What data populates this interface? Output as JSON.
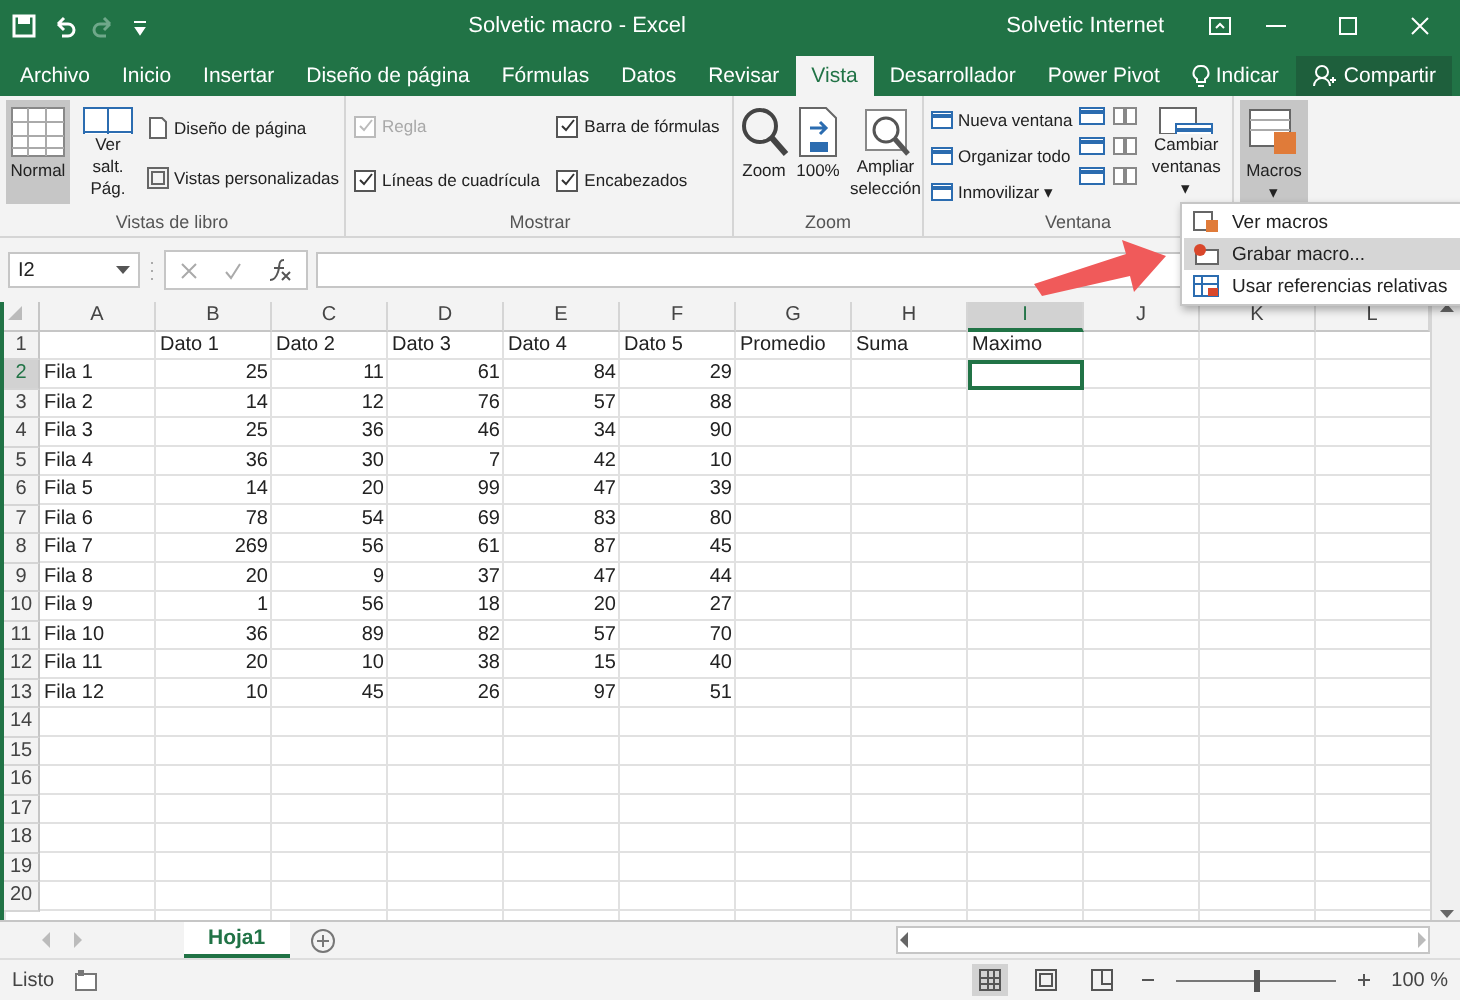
{
  "window": {
    "title": "Solvetic macro  -  Excel",
    "account": "Solvetic Internet"
  },
  "tabs": [
    {
      "label": "Archivo",
      "selected": false
    },
    {
      "label": "Inicio",
      "selected": false
    },
    {
      "label": "Insertar",
      "selected": false
    },
    {
      "label": "Diseño de página",
      "selected": false
    },
    {
      "label": "Fórmulas",
      "selected": false
    },
    {
      "label": "Datos",
      "selected": false
    },
    {
      "label": "Revisar",
      "selected": false
    },
    {
      "label": "Vista",
      "selected": true
    },
    {
      "label": "Desarrollador",
      "selected": false
    },
    {
      "label": "Power Pivot",
      "selected": false
    }
  ],
  "tell_me": "Indicar",
  "share": "Compartir",
  "ribbon": {
    "views": {
      "label": "Vistas de libro",
      "large": [
        {
          "label": "Normal",
          "selected": true
        },
        {
          "label": "Ver salt. Pág.",
          "selected": false
        }
      ],
      "small": [
        "Diseño de página",
        "Vistas personalizadas"
      ]
    },
    "show": {
      "label": "Mostrar",
      "checks": [
        {
          "label": "Regla",
          "checked": true,
          "disabled": true
        },
        {
          "label": "Líneas de cuadrícula",
          "checked": true,
          "disabled": false
        },
        {
          "label": "Barra de fórmulas",
          "checked": true,
          "disabled": false
        },
        {
          "label": "Encabezados",
          "checked": true,
          "disabled": false
        }
      ]
    },
    "zoom": {
      "label": "Zoom",
      "buttons": [
        "Zoom",
        "100%",
        "Ampliar selección"
      ]
    },
    "window": {
      "label": "Ventana",
      "small": [
        "Nueva ventana",
        "Organizar todo",
        "Inmovilizar ▾"
      ],
      "switch": "Cambiar ventanas ▾"
    },
    "macros": {
      "label": "Macros",
      "caret": "▾",
      "selected": true
    }
  },
  "macro_menu": [
    {
      "label": "Ver macros",
      "selected": false
    },
    {
      "label": "Grabar macro...",
      "selected": true
    },
    {
      "label": "Usar referencias relativas",
      "selected": false
    }
  ],
  "name_box": "I2",
  "columns": [
    {
      "letter": "A",
      "selected": false
    },
    {
      "letter": "B",
      "selected": false
    },
    {
      "letter": "C",
      "selected": false
    },
    {
      "letter": "D",
      "selected": false
    },
    {
      "letter": "E",
      "selected": false
    },
    {
      "letter": "F",
      "selected": false
    },
    {
      "letter": "G",
      "selected": false
    },
    {
      "letter": "H",
      "selected": false
    },
    {
      "letter": "I",
      "selected": true
    },
    {
      "letter": "J",
      "selected": false
    },
    {
      "letter": "K",
      "selected": false
    },
    {
      "letter": "L",
      "selected": false
    }
  ],
  "rows": [
    {
      "number": "1",
      "selected": false,
      "cells": [
        null,
        "Dato 1",
        "Dato 2",
        "Dato 3",
        "Dato 4",
        "Dato 5",
        "Promedio",
        "Suma",
        "Maximo"
      ]
    },
    {
      "number": "2",
      "selected": true,
      "cells": [
        "Fila 1",
        "25",
        "11",
        "61",
        "84",
        "29"
      ]
    },
    {
      "number": "3",
      "selected": false,
      "cells": [
        "Fila 2",
        "14",
        "12",
        "76",
        "57",
        "88"
      ]
    },
    {
      "number": "4",
      "selected": false,
      "cells": [
        "Fila 3",
        "25",
        "36",
        "46",
        "34",
        "90"
      ]
    },
    {
      "number": "5",
      "selected": false,
      "cells": [
        "Fila 4",
        "36",
        "30",
        "7",
        "42",
        "10"
      ]
    },
    {
      "number": "6",
      "selected": false,
      "cells": [
        "Fila 5",
        "14",
        "20",
        "99",
        "47",
        "39"
      ]
    },
    {
      "number": "7",
      "selected": false,
      "cells": [
        "Fila 6",
        "78",
        "54",
        "69",
        "83",
        "80"
      ]
    },
    {
      "number": "8",
      "selected": false,
      "cells": [
        "Fila 7",
        "269",
        "56",
        "61",
        "87",
        "45"
      ]
    },
    {
      "number": "9",
      "selected": false,
      "cells": [
        "Fila 8",
        "20",
        "9",
        "37",
        "47",
        "44"
      ]
    },
    {
      "number": "10",
      "selected": false,
      "cells": [
        "Fila 9",
        "1",
        "56",
        "18",
        "20",
        "27"
      ]
    },
    {
      "number": "11",
      "selected": false,
      "cells": [
        "Fila 10",
        "36",
        "89",
        "82",
        "57",
        "70"
      ]
    },
    {
      "number": "12",
      "selected": false,
      "cells": [
        "Fila 11",
        "20",
        "10",
        "38",
        "15",
        "40"
      ]
    },
    {
      "number": "13",
      "selected": false,
      "cells": [
        "Fila 12",
        "10",
        "45",
        "26",
        "97",
        "51"
      ]
    },
    {
      "number": "14",
      "selected": false,
      "cells": []
    },
    {
      "number": "15",
      "selected": false,
      "cells": []
    },
    {
      "number": "16",
      "selected": false,
      "cells": []
    },
    {
      "number": "17",
      "selected": false,
      "cells": []
    },
    {
      "number": "18",
      "selected": false,
      "cells": []
    },
    {
      "number": "19",
      "selected": false,
      "cells": []
    },
    {
      "number": "20",
      "selected": false,
      "cells": []
    }
  ],
  "sheets": [
    {
      "label": "Hoja1",
      "selected": true
    }
  ],
  "status": {
    "text": "Listo",
    "views": [
      {
        "kind": "normal",
        "selected": true
      },
      {
        "kind": "layout",
        "selected": false
      },
      {
        "kind": "pagebreak",
        "selected": false
      }
    ],
    "zoom": "100 %",
    "zoom_level": {
      "level": 0.5
    }
  }
}
